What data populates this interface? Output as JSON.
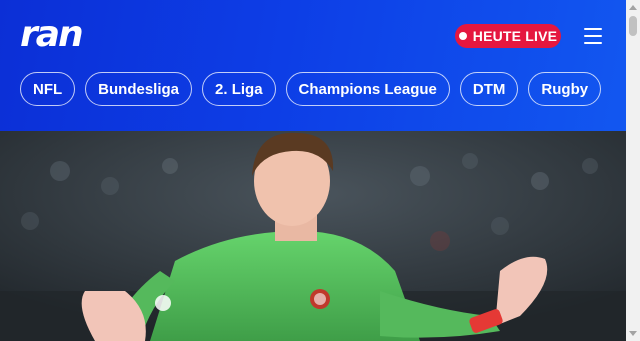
{
  "header": {
    "logo_text": "ran",
    "live_button_label": "HEUTE LIVE",
    "menu_icon": "hamburger-menu-icon"
  },
  "nav": {
    "items": [
      {
        "label": "NFL"
      },
      {
        "label": "Bundesliga"
      },
      {
        "label": "2. Liga"
      },
      {
        "label": "Champions League"
      },
      {
        "label": "DTM"
      },
      {
        "label": "Rugby"
      }
    ]
  },
  "hero": {
    "image_description": "Goalkeeper in green kit gesturing with gloved hands"
  },
  "colors": {
    "header_blue": "#0d3ee6",
    "live_red": "#e5173f",
    "keeper_green": "#57c25e"
  }
}
